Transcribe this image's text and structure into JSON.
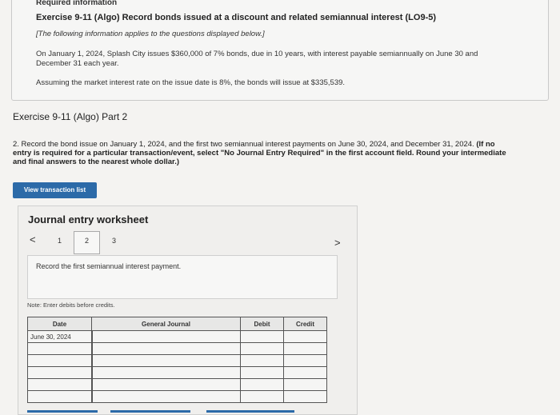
{
  "info": {
    "required": "Required information",
    "exercise_title": "Exercise 9-11 (Algo) Record bonds issued at a discount and related semiannual interest (LO9-5)",
    "note": "[The following information applies to the questions displayed below.]",
    "paragraph1": "On January 1, 2024, Splash City issues $360,000 of 7% bonds, due in 10 years, with interest payable semiannually on June 30 and December 31 each year.",
    "paragraph2": "Assuming the market interest rate on the issue date is 8%, the bonds will issue at $335,539."
  },
  "part_title": "Exercise 9-11 (Algo) Part 2",
  "question": {
    "text": "2. Record the bond issue on January 1, 2024, and the first two semiannual interest payments on June 30, 2024, and December 31, 2024.",
    "bold": "(If no entry is required for a particular transaction/event, select \"No Journal Entry Required\" in the first account field. Round your intermediate and final answers to the nearest whole dollar.)"
  },
  "view_button_label": "View transaction list",
  "worksheet": {
    "title": "Journal entry worksheet",
    "prev_icon": "<",
    "next_icon": ">",
    "pages": [
      "1",
      "2",
      "3"
    ],
    "current_page": "2",
    "instruction": "Record the first semiannual interest payment.",
    "note": "Note: Enter debits before credits.",
    "columns": [
      "Date",
      "General Journal",
      "Debit",
      "Credit"
    ],
    "rows": [
      {
        "date": "June 30, 2024",
        "account": "",
        "debit": "",
        "credit": ""
      },
      {
        "date": "",
        "account": "",
        "debit": "",
        "credit": ""
      },
      {
        "date": "",
        "account": "",
        "debit": "",
        "credit": ""
      },
      {
        "date": "",
        "account": "",
        "debit": "",
        "credit": ""
      },
      {
        "date": "",
        "account": "",
        "debit": "",
        "credit": ""
      },
      {
        "date": "",
        "account": "",
        "debit": "",
        "credit": ""
      }
    ]
  }
}
